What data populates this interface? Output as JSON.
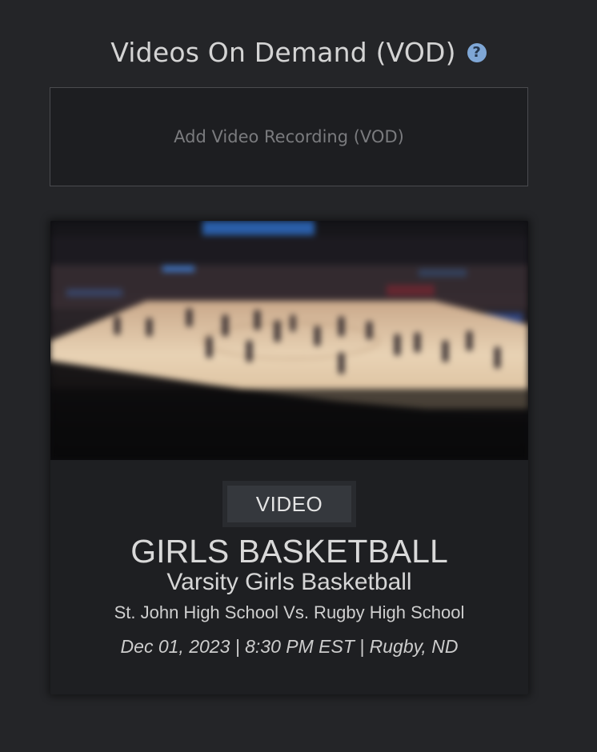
{
  "header": {
    "title": "Videos On Demand (VOD)",
    "help_icon": "question-circle-icon",
    "help_glyph": "?"
  },
  "add_vod": {
    "label": "Add Video Recording (VOD)"
  },
  "vod_card": {
    "badge": "VIDEO",
    "sport": "GIRLS BASKETBALL",
    "team": "Varsity Girls Basketball",
    "matchup": "St. John High School Vs. Rugby High School",
    "meta": "Dec 01, 2023 | 8:30 PM EST | Rugby, ND"
  },
  "colors": {
    "background": "#242528",
    "card": "#1e1f22",
    "help_icon": "#7fa7d6",
    "badge": "#35383d"
  }
}
